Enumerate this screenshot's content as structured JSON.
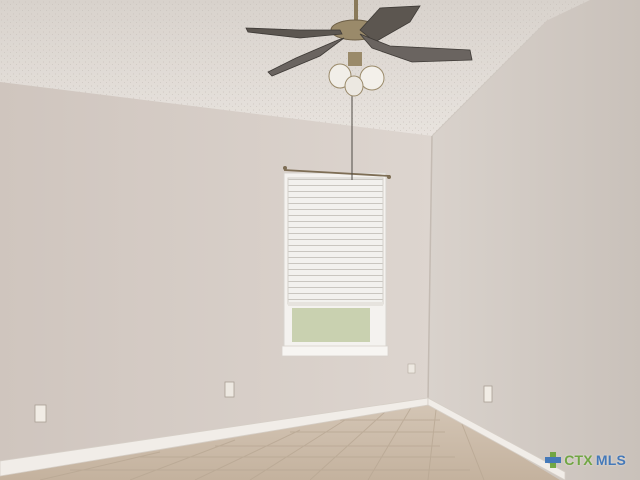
{
  "photo": {
    "subject": "empty-room",
    "elements": [
      "ceiling-fan",
      "window-with-blinds",
      "tile-floor",
      "baseboards",
      "electrical-outlets"
    ]
  },
  "watermark": {
    "brand_part1": "CTX",
    "brand_part2": "MLS",
    "colors": {
      "ctx": "#6aa43a",
      "mls": "#3a73b8"
    }
  },
  "colors": {
    "ceiling": "#e4dfd9",
    "left_wall": "#d8cfc8",
    "right_wall": "#cec6bf",
    "floor": "#cbbba9",
    "trim": "#efebe6",
    "fan_metal": "#9a8a6a"
  }
}
